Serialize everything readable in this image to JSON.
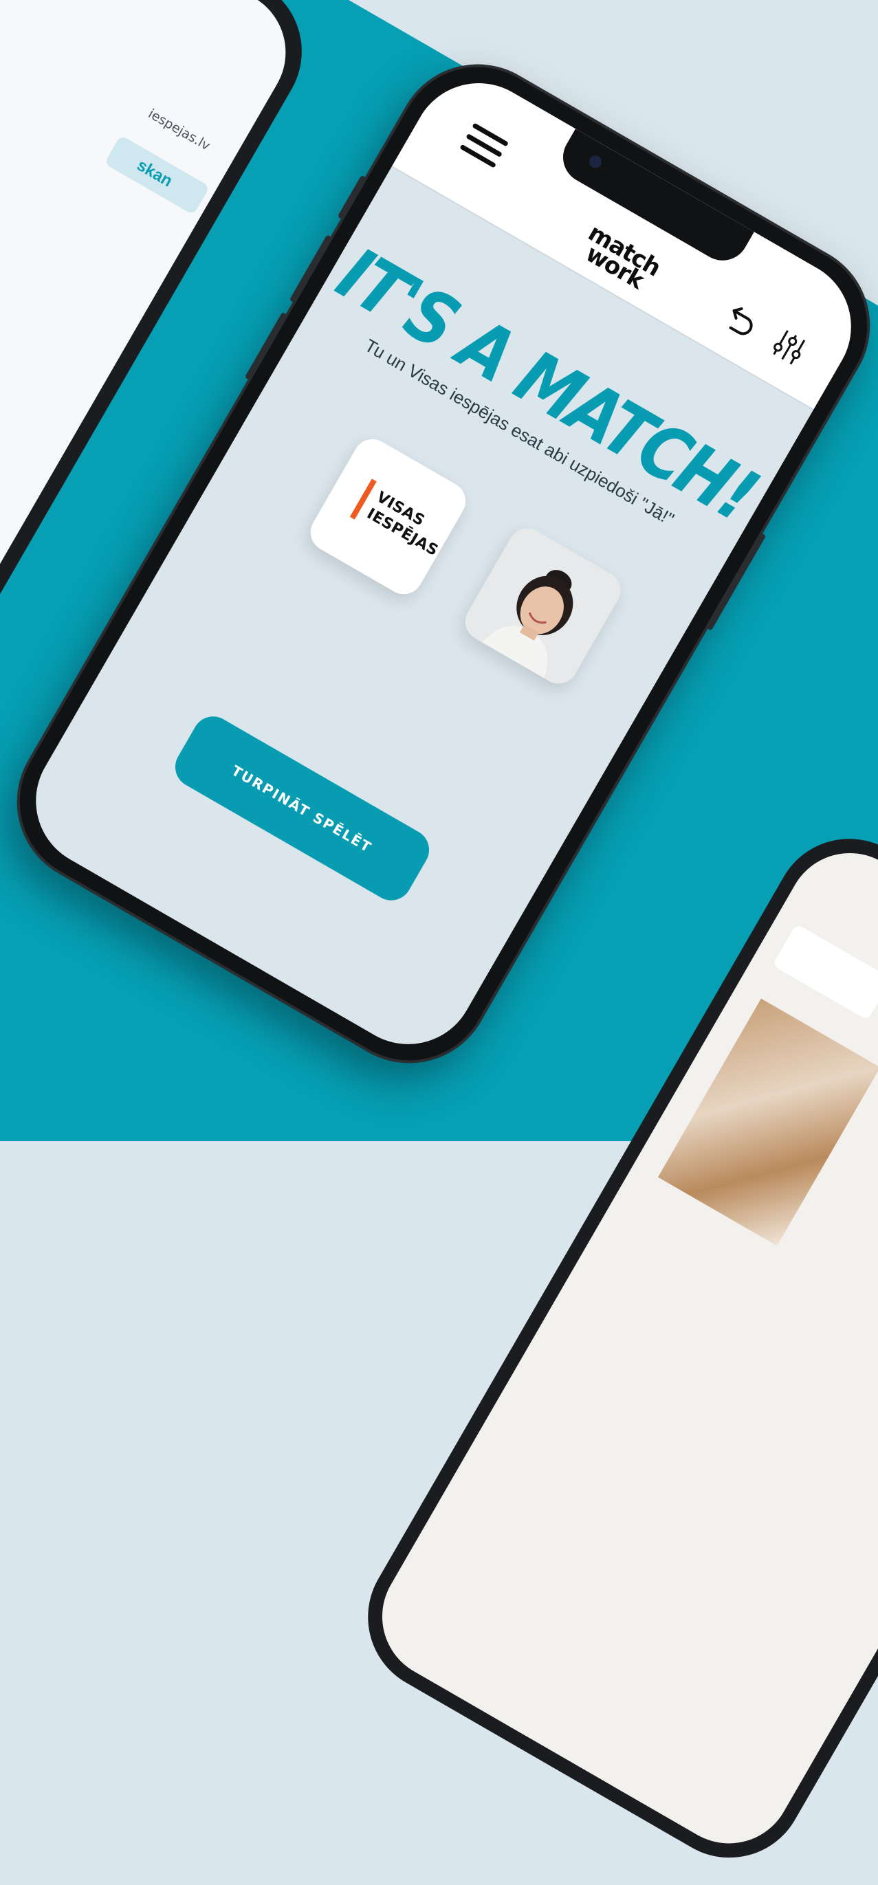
{
  "background_phone_left": {
    "url_text": "iespejas.lv",
    "button_label": "skan"
  },
  "header": {
    "logo_line1": "match",
    "logo_line2": "work",
    "menu_icon": "hamburger-menu-icon",
    "undo_icon": "undo-arrow-icon",
    "filter_icon": "filter-sliders-icon"
  },
  "match": {
    "headline": "IT'S A MATCH!",
    "subtitle": "Tu un Visas iespējas esat abi uzpiedoši \"Jā!\"",
    "company_logo_line1": "VISAS",
    "company_logo_line2": "IESPĒJAS",
    "continue_button_label": "TURPINĀT SPĒLĒT"
  },
  "colors": {
    "brand_teal": "#079cb1",
    "background_light": "#dae5ec",
    "logo_accent": "#ef5a23"
  }
}
